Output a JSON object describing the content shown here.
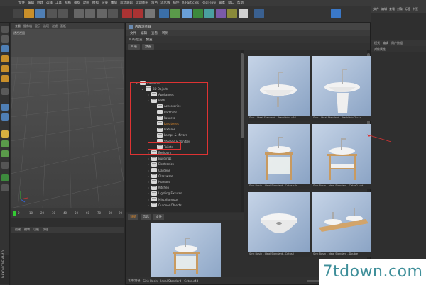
{
  "app": {
    "menu": [
      "文件",
      "编辑",
      "创建",
      "选择",
      "工具",
      "网格",
      "捕捉",
      "动画",
      "模拟",
      "渲染",
      "雕刻",
      "运动跟踪",
      "运动图形",
      "角色",
      "流水线",
      "插件",
      "X-Particles",
      "RealFlow",
      "脚本",
      "窗口",
      "帮助"
    ]
  },
  "viewport": {
    "menu": [
      "查看",
      "摄像机",
      "显示",
      "选项",
      "过滤",
      "面板"
    ],
    "label": "透视视图"
  },
  "timeline": {
    "start": "0",
    "ticks": [
      "0",
      "10",
      "20",
      "30",
      "40",
      "50",
      "60",
      "70",
      "80",
      "90"
    ]
  },
  "bottom_left": {
    "menu": [
      "创建",
      "编辑",
      "功能",
      "纹理"
    ]
  },
  "browser": {
    "title": "内容浏览器",
    "menu": [
      "文件",
      "编辑",
      "查看",
      "转到"
    ],
    "location_label": "目录/位置",
    "location_value": "预置",
    "tabs": [
      "目录",
      "预置"
    ],
    "preview_tabs": [
      "预览",
      "信息",
      "文件"
    ],
    "status_text": "Sink Basin - Ideal Standard - Cetus.c4d",
    "status_label": "名称/路径",
    "slider_level": 0.6,
    "tree": [
      {
        "label": "Visualize",
        "depth": 0
      },
      {
        "label": "3D Objects",
        "depth": 1
      },
      {
        "label": "Appliances",
        "depth": 2
      },
      {
        "label": "Bath",
        "depth": 2
      },
      {
        "label": "Accessories",
        "depth": 3
      },
      {
        "label": "Bathtubs",
        "depth": 3
      },
      {
        "label": "Faucets",
        "depth": 3
      },
      {
        "label": "Lavatories",
        "depth": 3,
        "selected": true
      },
      {
        "label": "Fixtures",
        "depth": 3
      },
      {
        "label": "Lamps & Mirrors",
        "depth": 3
      },
      {
        "label": "Storage & Vanities",
        "depth": 3
      },
      {
        "label": "Toilets",
        "depth": 3
      },
      {
        "label": "Bedroom",
        "depth": 2
      },
      {
        "label": "Buildings",
        "depth": 2
      },
      {
        "label": "Electronics",
        "depth": 2
      },
      {
        "label": "Gardens",
        "depth": 2
      },
      {
        "label": "Glassware",
        "depth": 2
      },
      {
        "label": "Humans",
        "depth": 2
      },
      {
        "label": "Kitchen",
        "depth": 2
      },
      {
        "label": "Lighting Fixtures",
        "depth": 2
      },
      {
        "label": "Miscellaneous",
        "depth": 2
      },
      {
        "label": "Outdoor Objects",
        "depth": 2
      }
    ],
    "thumbs": [
      {
        "caption": "Sink - Ideal Standard - WashPoint.c4d"
      },
      {
        "caption": "Sink - Ideal Standard - WashPoint2.c4d"
      },
      {
        "caption": "Sink Basin - Ideal Standard - Cetus.c4d"
      },
      {
        "caption": "Sink Basin - Ideal Standard - Cetus2.c4d"
      },
      {
        "caption": "Sink Basin - Ideal Standard - Cetus3"
      },
      {
        "caption": "Sink Basin - Ideal Standard - Double"
      }
    ]
  },
  "right_panel": {
    "top": [
      "文件",
      "编辑",
      "查看",
      "对象",
      "标签",
      "书签"
    ],
    "menu": [
      "模式",
      "编辑",
      "用户数据"
    ],
    "sub": [
      "对象属性"
    ]
  },
  "side_tab": "MAXON CINEMA 4D",
  "watermark": "7tdown.com",
  "colors": {
    "highlight_red": "#dd3333",
    "selected_orange": "#e08a2a",
    "watermark": "#3f8f9a"
  }
}
